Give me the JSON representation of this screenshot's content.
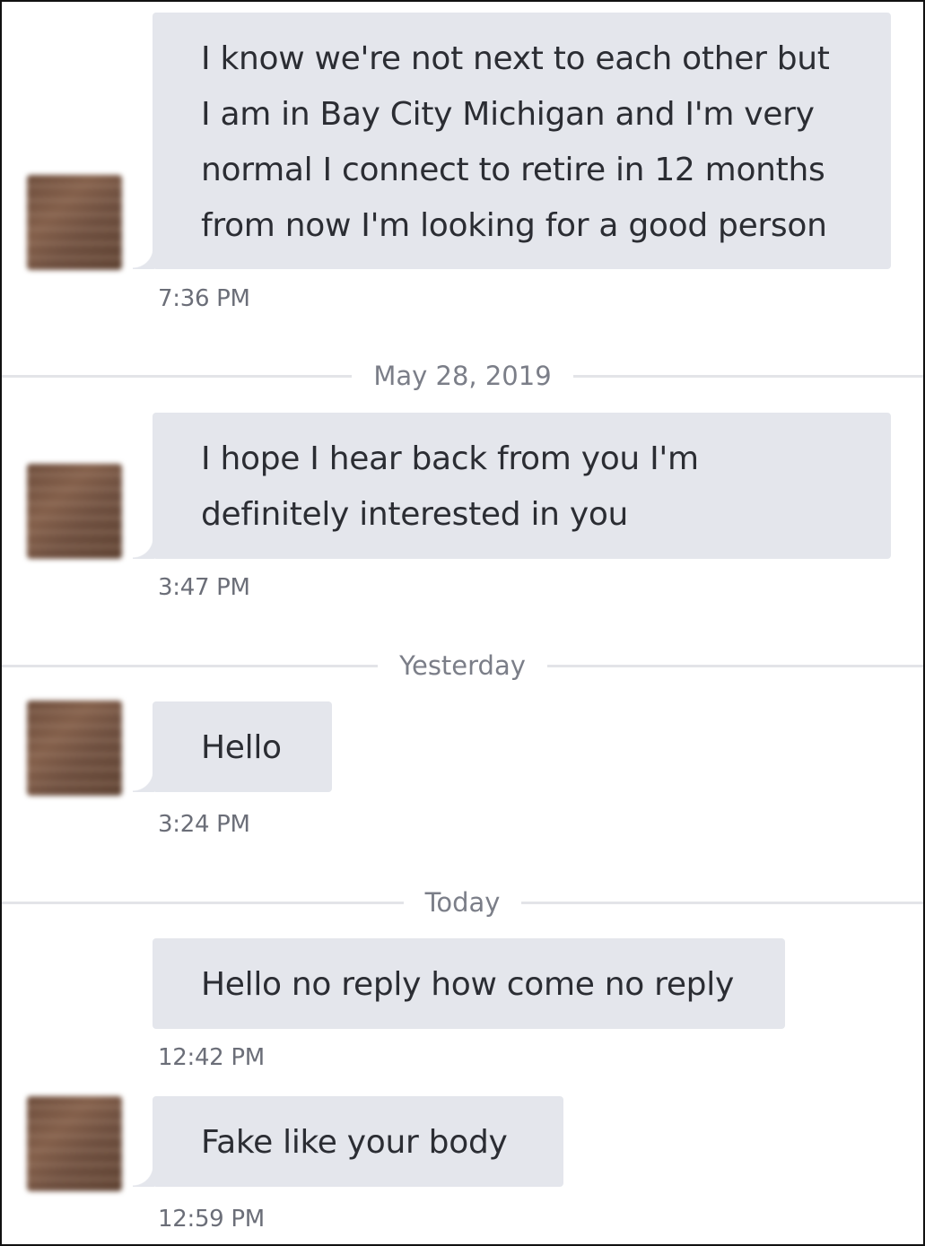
{
  "messages": [
    {
      "lines": [
        "I know we're not next to each other but",
        "I am in Bay City Michigan and I'm very",
        "normal I connect to retire in 12 months",
        "from now I'm looking for a good person"
      ],
      "time": "7:36 PM"
    },
    {
      "lines": [
        "I hope I hear back from you I'm",
        "definitely interested in you"
      ],
      "time": "3:47 PM"
    },
    {
      "lines": [
        "Hello"
      ],
      "time": "3:24 PM"
    },
    {
      "lines": [
        "Hello no reply how come no reply"
      ],
      "time": "12:42 PM"
    },
    {
      "lines": [
        "Fake like your body"
      ],
      "time": "12:59 PM"
    }
  ],
  "dividers": {
    "may28": "May 28, 2019",
    "yesterday": "Yesterday",
    "today": "Today"
  },
  "colors": {
    "bubble": "#e4e6ec",
    "text": "#2b2d33",
    "timestamp": "#6b6e78",
    "divider_line": "#e3e4e8"
  },
  "icons": {
    "avatar": "blurred-profile-photo"
  }
}
